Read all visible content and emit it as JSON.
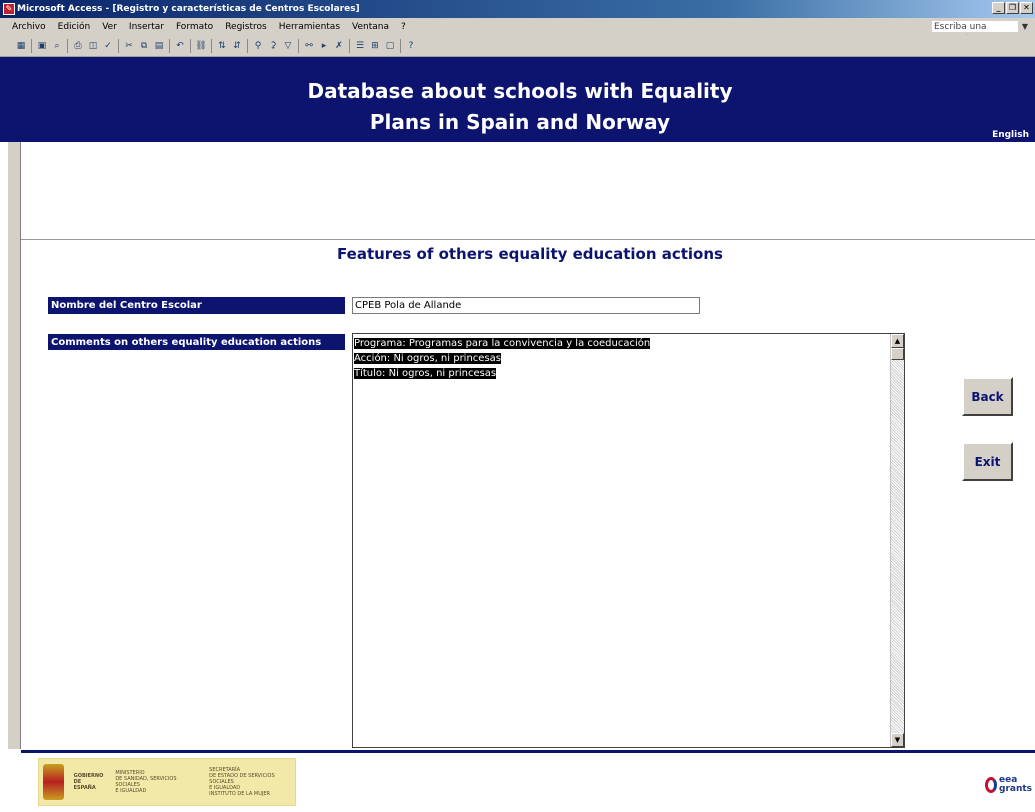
{
  "window": {
    "title": "Microsoft Access - [Registro y características de Centros Escolares]"
  },
  "menubar": {
    "items": [
      "Archivo",
      "Edición",
      "Ver",
      "Insertar",
      "Formato",
      "Registros",
      "Herramientas",
      "Ventana",
      "?"
    ],
    "ask_placeholder": "Escriba una pregunta"
  },
  "toolbar": {
    "buttons": [
      "view-icon",
      "save-icon",
      "search-icon",
      "print-icon",
      "print-preview-icon",
      "spelling-icon",
      "cut-icon",
      "copy-icon",
      "paste-icon",
      "undo-icon",
      "hyperlink-icon",
      "sort-ascending-icon",
      "sort-descending-icon",
      "filter-selection-icon",
      "filter-form-icon",
      "apply-filter-icon",
      "find-icon",
      "new-record-icon",
      "delete-record-icon",
      "properties-icon",
      "database-window-icon",
      "new-object-icon",
      "help-icon"
    ]
  },
  "header": {
    "title_line1": "Database about schools with Equality",
    "title_line2": "Plans in Spain and Norway",
    "language": "English"
  },
  "form": {
    "section_title": "Features of others equality education actions",
    "name_label": "Nombre del Centro Escolar",
    "name_value": "CPEB Pola de Allande",
    "comments_label": "Comments on others equality education actions",
    "comments_lines": [
      "Programa: Programas para la convivencia y la coeducación",
      "Acción: Ni ogros, ni princesas",
      "Título: Ni ogros, ni princesas"
    ]
  },
  "buttons": {
    "back": "Back",
    "exit": "Exit"
  },
  "footer": {
    "spain_logo_text": [
      "GOBIERNO",
      "DE ESPAÑA"
    ],
    "ministry_text": [
      "MINISTERIO",
      "DE SANIDAD, SERVICIOS SOCIALES",
      "E IGUALDAD"
    ],
    "institute_text": [
      "SECRETARÍA",
      "DE ESTADO DE SERVICIOS SOCIALES",
      "E IGUALDAD",
      "INSTITUTO DE LA MUJER"
    ],
    "eea_text": [
      "eea",
      "grants"
    ]
  },
  "colors": {
    "brand_navy": "#0c1470",
    "window_chrome": "#d4d0c8"
  }
}
